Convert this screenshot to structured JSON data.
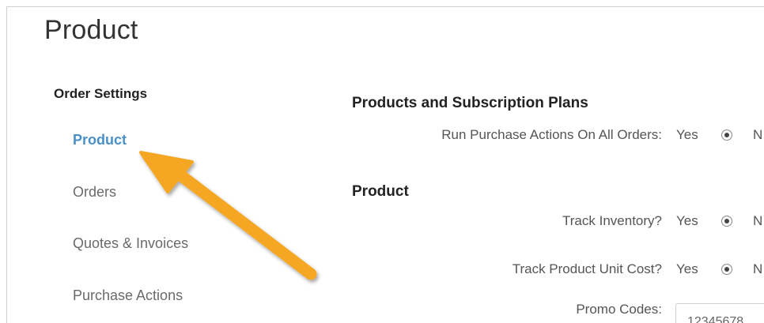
{
  "page": {
    "title": "Product"
  },
  "sidebar": {
    "heading": "Order Settings",
    "items": [
      {
        "label": "Product",
        "active": true
      },
      {
        "label": "Orders"
      },
      {
        "label": "Quotes & Invoices"
      },
      {
        "label": "Purchase Actions"
      }
    ]
  },
  "sections": {
    "subscriptions": {
      "title": "Products and Subscription Plans",
      "rows": [
        {
          "label": "Run Purchase Actions On All Orders:",
          "yes": "Yes",
          "no": "N"
        }
      ]
    },
    "product": {
      "title": "Product",
      "rows": [
        {
          "label": "Track Inventory?",
          "yes": "Yes",
          "no": "N"
        },
        {
          "label": "Track Product Unit Cost?",
          "yes": "Yes",
          "no": "N"
        }
      ],
      "promo": {
        "label": "Promo Codes:",
        "value": "12345678"
      }
    }
  },
  "colors": {
    "active_link": "#4a90c8",
    "arrow": "#f5a623"
  }
}
